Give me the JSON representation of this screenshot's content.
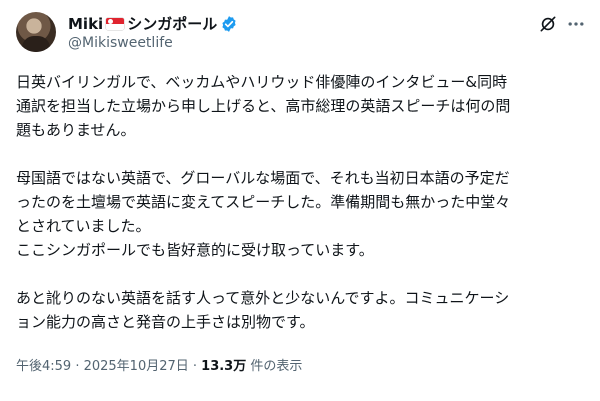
{
  "tweet": {
    "display_name": "Miki",
    "display_name_suffix": "シンガポール",
    "flag_icon": "singapore-flag-icon",
    "verified_icon": "verified-badge-icon",
    "handle": "@Mikisweetlife",
    "grok_icon": "grok-icon",
    "more_icon": "more-options-icon",
    "text": "日英バイリンガルで、ベッカムやハリウッド俳優陣のインタビュー&同時\n通訳を担当した立場から申し上げると、高市総理の英語スピーチは何の問\n題もありません。\n\n母国語ではない英語で、グローバルな場面で、それも当初日本語の予定だ\nったのを土壇場で英語に変えてスピーチした。準備期間も無かった中堂々\nとされていました。\nここシンガポールでも皆好意的に受け取っています。\n\nあと訛りのない英語を話す人って意外と少ないんですよ。コミュニケーシ\nョン能力の高さと発音の上手さは別物です。",
    "timestamp": "午後4:59 · 2025年10月27日 · ",
    "views": "13.3万",
    "views_label": " 件の表示"
  },
  "colors": {
    "text": "#0f1419",
    "secondary": "#536471",
    "verified": "#1d9bf0"
  }
}
